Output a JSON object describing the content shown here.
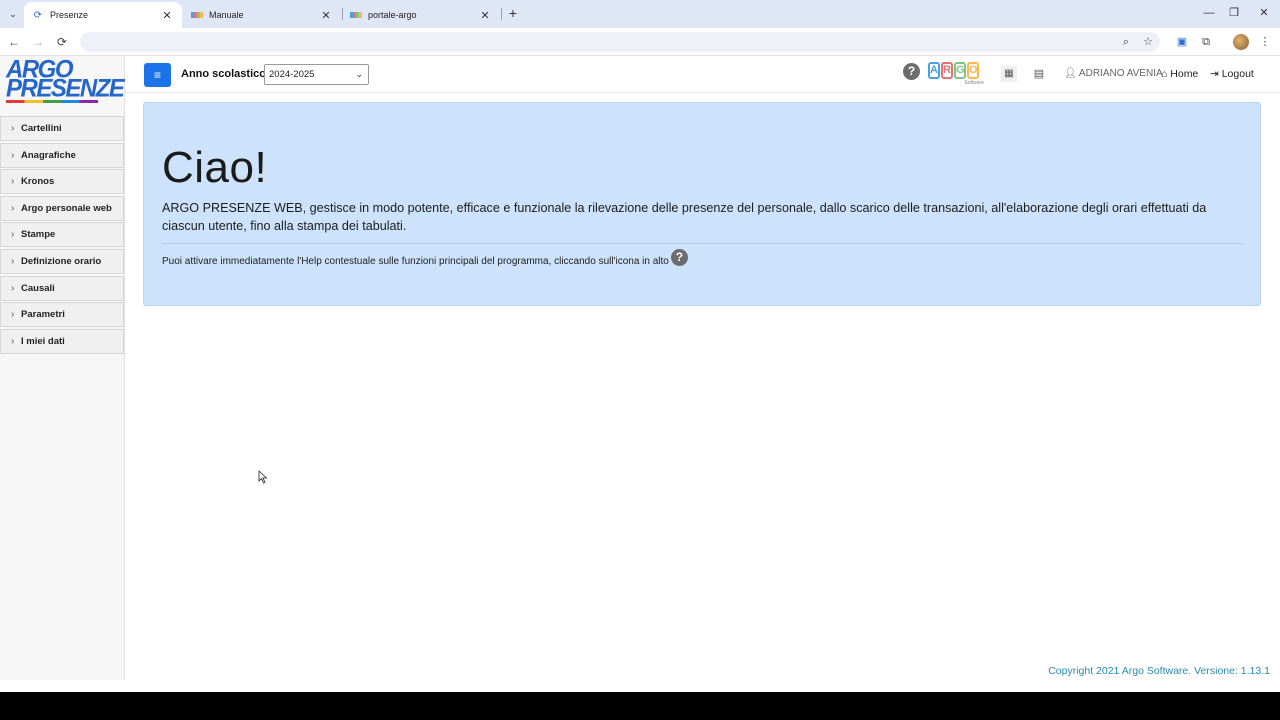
{
  "browser": {
    "tabs": [
      {
        "title": "Presenze",
        "active": true,
        "favicon": "argo-presenze-icon"
      },
      {
        "title": "Manuale",
        "active": false,
        "favicon": "argo-multicolor-icon"
      },
      {
        "title": "portale-argo",
        "active": false,
        "favicon": "argo-multicolor-icon"
      }
    ],
    "new_tab_label": "+",
    "url": ""
  },
  "app": {
    "logo": {
      "line1": "ARGO",
      "line2": "PRESENZE"
    },
    "menu": [
      {
        "label": "Cartellini"
      },
      {
        "label": "Anagrafiche"
      },
      {
        "label": "Kronos"
      },
      {
        "label": "Argo personale web"
      },
      {
        "label": "Stampe"
      },
      {
        "label": "Definizione orario"
      },
      {
        "label": "Causali"
      },
      {
        "label": "Parametri"
      },
      {
        "label": "I miei dati"
      }
    ],
    "topbar": {
      "anno_label": "Anno scolastico:",
      "anno_value": "2024-2025",
      "argo_logo_letters": [
        "A",
        "R",
        "G",
        "O"
      ],
      "argo_logo_sub": "Software",
      "user": "ADRIANO AVENIA",
      "home": "Home",
      "logout": "Logout"
    },
    "welcome": {
      "title": "Ciao!",
      "lead": "ARGO PRESENZE WEB, gestisce in modo potente, efficace e funzionale la rilevazione delle presenze del personale, dallo scarico delle transazioni, all'elaborazione degli orari effettuati da ciascun utente, fino alla stampa dei tabulati.",
      "hint": "Puoi attivare immediatamente l'Help contestuale sulle funzioni principali del programma, cliccando sull'icona in alto"
    },
    "footer": "Copyright 2021 Argo Software. Versione: 1.13.1"
  },
  "colors": {
    "accent": "#1a73e8",
    "logo_blue": "#2566c8",
    "jumbotron_bg": "#cde2fb",
    "footer_text": "#2a8ab0",
    "argo_letters": [
      "#4a9fe0",
      "#e57373",
      "#81c784",
      "#ffb74d"
    ]
  }
}
